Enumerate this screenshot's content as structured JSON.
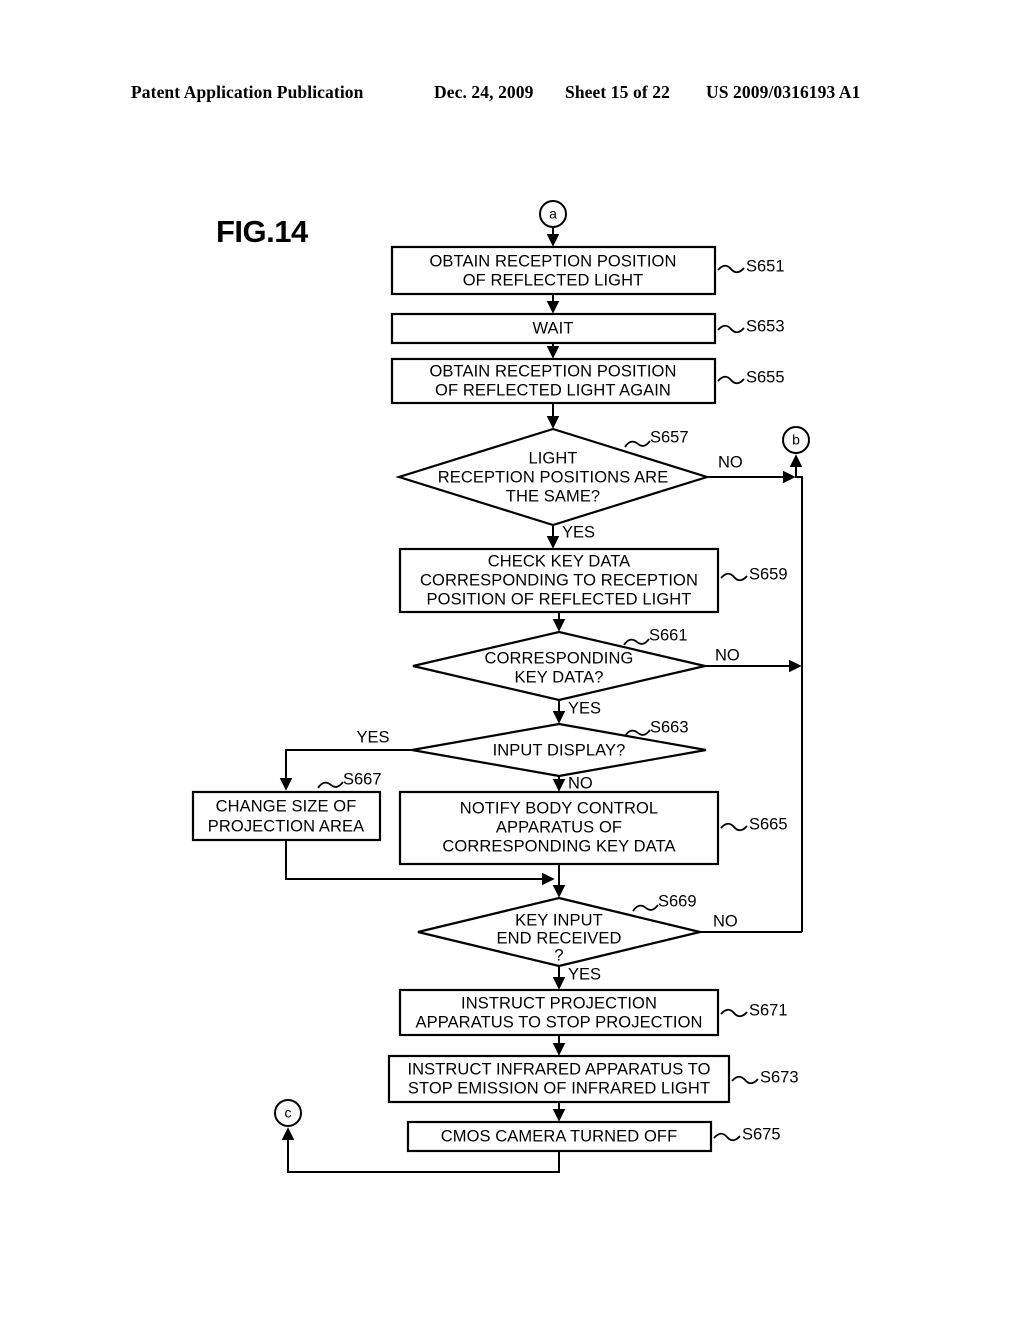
{
  "header": {
    "publication": "Patent Application Publication",
    "date": "Dec. 24, 2009",
    "sheet": "Sheet 15 of 22",
    "patent_number": "US 2009/0316193 A1"
  },
  "figure": {
    "label": "FIG.14"
  },
  "connectors": {
    "a": "a",
    "b": "b",
    "c": "c"
  },
  "branches": {
    "yes": "YES",
    "no": "NO"
  },
  "nodes": {
    "s651": {
      "step": "S651",
      "line1": "OBTAIN RECEPTION POSITION",
      "line2": "OF REFLECTED LIGHT"
    },
    "s653": {
      "step": "S653",
      "line1": "WAIT"
    },
    "s655": {
      "step": "S655",
      "line1": "OBTAIN RECEPTION POSITION",
      "line2": "OF REFLECTED LIGHT AGAIN"
    },
    "s657": {
      "step": "S657",
      "line1": "LIGHT",
      "line2": "RECEPTION POSITIONS ARE",
      "line3": "THE SAME?",
      "yes": "YES",
      "no": "NO"
    },
    "s659": {
      "step": "S659",
      "line1": "CHECK KEY DATA",
      "line2": "CORRESPONDING TO RECEPTION",
      "line3": "POSITION OF REFLECTED LIGHT"
    },
    "s661": {
      "step": "S661",
      "line1": "CORRESPONDING",
      "line2": "KEY DATA?",
      "yes": "YES",
      "no": "NO"
    },
    "s663": {
      "step": "S663",
      "line1": "INPUT DISPLAY?",
      "yes": "YES",
      "no": "NO"
    },
    "s665": {
      "step": "S665",
      "line1": "NOTIFY BODY CONTROL",
      "line2": "APPARATUS OF",
      "line3": "CORRESPONDING KEY DATA"
    },
    "s667": {
      "step": "S667",
      "line1": "CHANGE SIZE OF",
      "line2": "PROJECTION AREA"
    },
    "s669": {
      "step": "S669",
      "line1": "KEY INPUT",
      "line2": "END RECEIVED",
      "line3": "?",
      "yes": "YES",
      "no": "NO"
    },
    "s671": {
      "step": "S671",
      "line1": "INSTRUCT PROJECTION",
      "line2": "APPARATUS TO STOP PROJECTION"
    },
    "s673": {
      "step": "S673",
      "line1": "INSTRUCT INFRARED APPARATUS TO",
      "line2": "STOP EMISSION OF INFRARED LIGHT"
    },
    "s675": {
      "step": "S675",
      "line1": "CMOS CAMERA TURNED OFF"
    }
  }
}
